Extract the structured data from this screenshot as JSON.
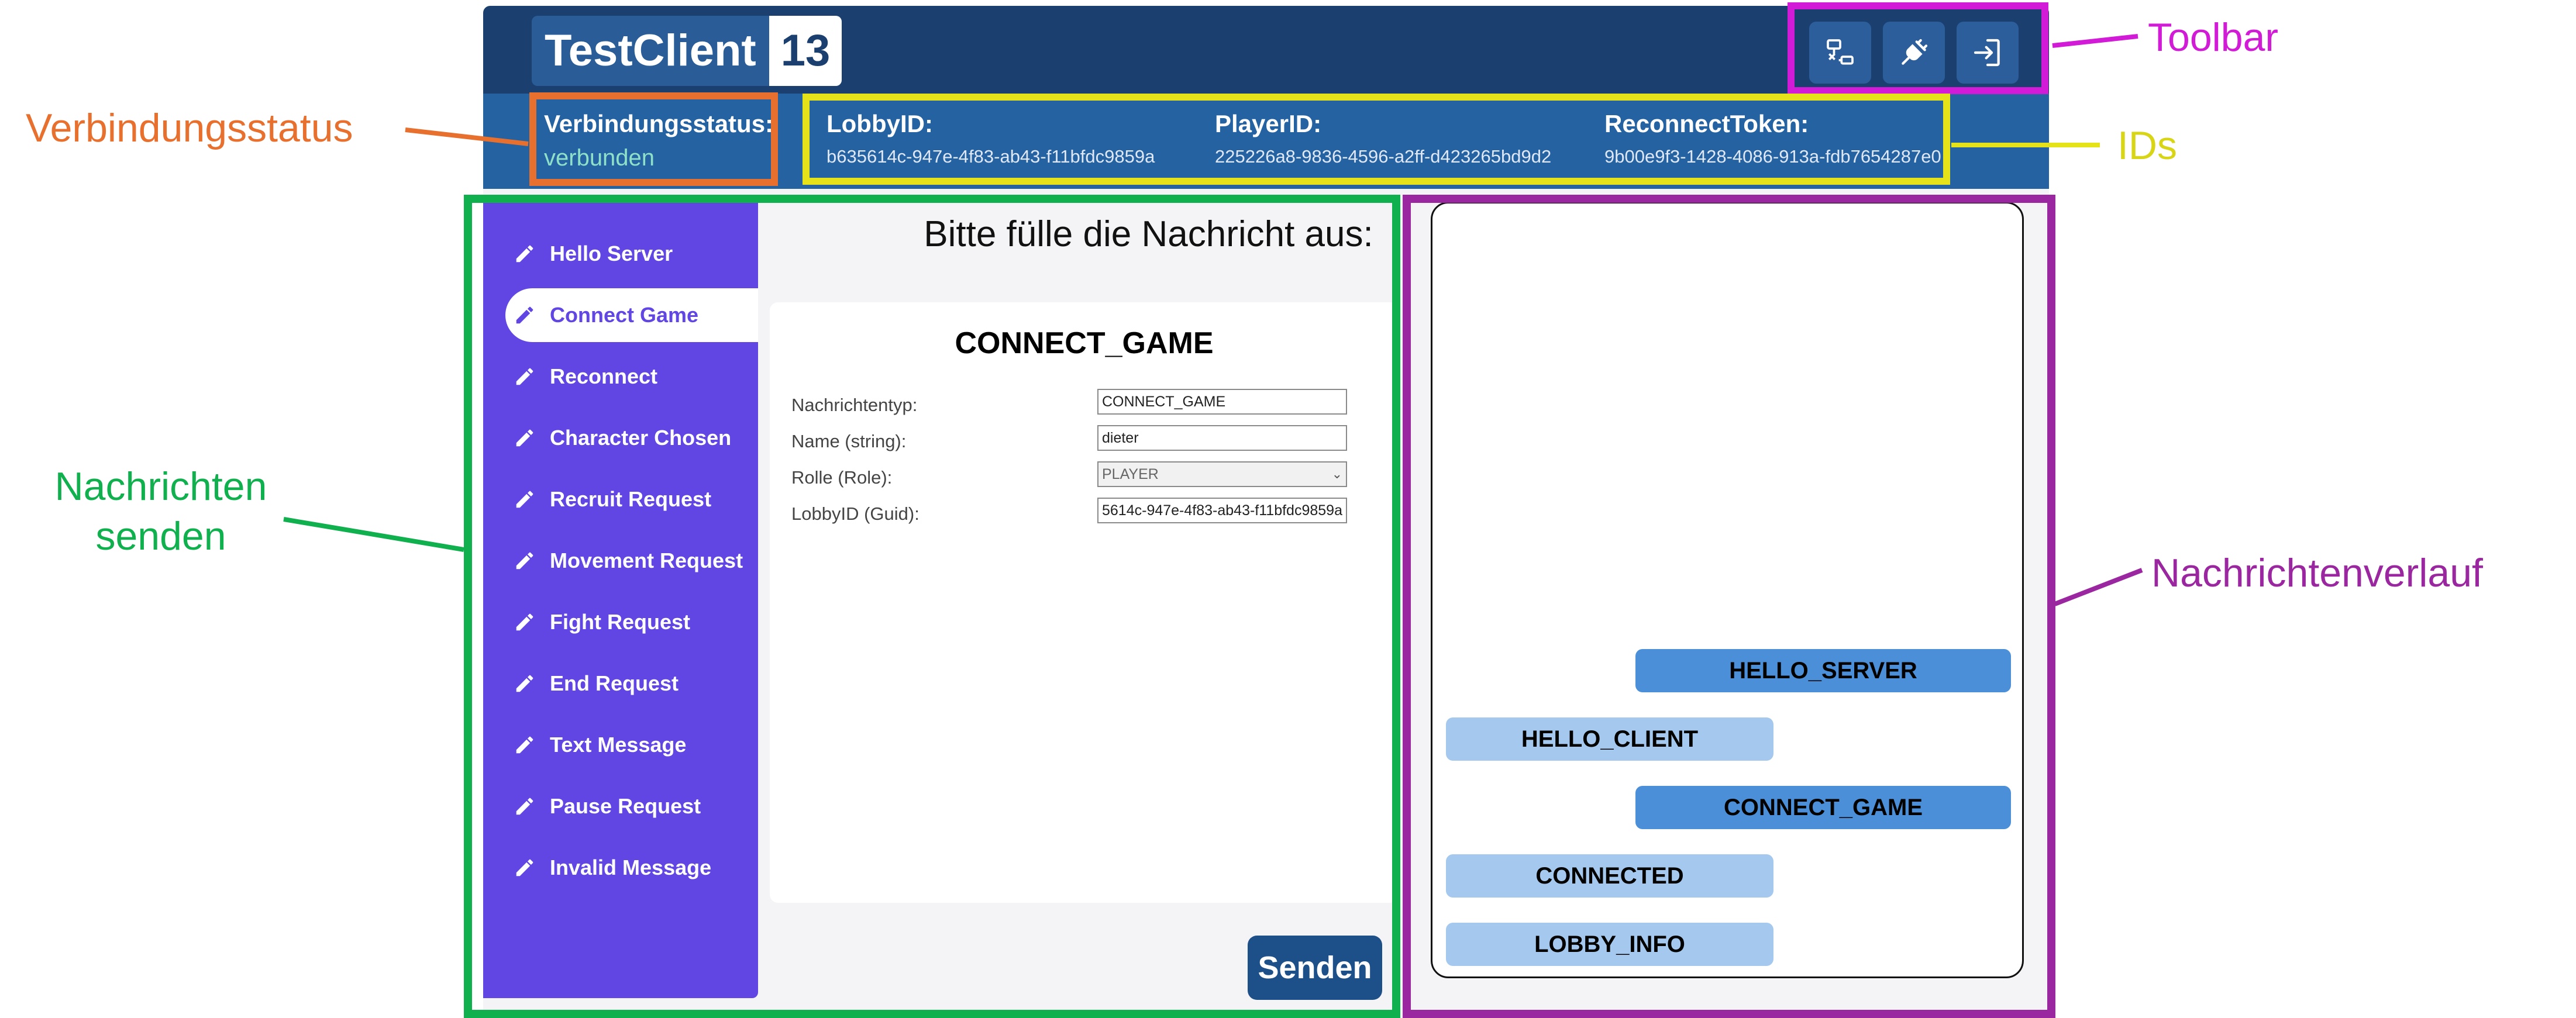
{
  "app": {
    "name": "TestClient",
    "version_badge": "13",
    "toolbar_icons": [
      "network-disconnect-icon",
      "plug-icon",
      "exit-icon"
    ]
  },
  "connection": {
    "label": "Verbindungsstatus:",
    "value": "verbunden"
  },
  "ids": [
    {
      "label": "LobbyID:",
      "value": "b635614c-947e-4f83-ab43-f11bfdc9859a"
    },
    {
      "label": "PlayerID:",
      "value": "225226a8-9836-4596-a2ff-d423265bd9d2"
    },
    {
      "label": "ReconnectToken:",
      "value": "9b00e9f3-1428-4086-913a-fdb7654287e0"
    }
  ],
  "sidebar": {
    "items": [
      {
        "label": "Hello Server"
      },
      {
        "label": "Connect Game",
        "active": true
      },
      {
        "label": "Reconnect"
      },
      {
        "label": "Character Chosen"
      },
      {
        "label": "Recruit Request"
      },
      {
        "label": "Movement Request"
      },
      {
        "label": "Fight Request"
      },
      {
        "label": "End Request"
      },
      {
        "label": "Text Message"
      },
      {
        "label": "Pause Request"
      },
      {
        "label": "Invalid Message"
      }
    ]
  },
  "form": {
    "prompt": "Bitte fülle die Nachricht aus:",
    "title": "CONNECT_GAME",
    "fields": [
      {
        "label": "Nachrichtentyp:",
        "value": "CONNECT_GAME"
      },
      {
        "label": "Name (string):",
        "value": "dieter"
      },
      {
        "label": "Rolle (Role):",
        "value": "PLAYER"
      },
      {
        "label": "LobbyID (Guid):",
        "value": "5614c-947e-4f83-ab43-f11bfdc9859a"
      }
    ],
    "send_label": "Senden"
  },
  "history": {
    "messages": [
      {
        "text": "HELLO_SERVER",
        "direction": "out"
      },
      {
        "text": "HELLO_CLIENT",
        "direction": "in"
      },
      {
        "text": "CONNECT_GAME",
        "direction": "out"
      },
      {
        "text": "CONNECTED",
        "direction": "in"
      },
      {
        "text": "LOBBY_INFO",
        "direction": "in"
      }
    ]
  },
  "annotations": {
    "toolbar": {
      "text": "Toolbar",
      "color": "#d21bd6"
    },
    "connection_status": {
      "text": "Verbindungsstatus",
      "color": "#e8702e"
    },
    "ids": {
      "text": "IDs",
      "color": "#e6e21a"
    },
    "send_messages": {
      "text": "Nachrichten\nsenden",
      "color": "#0fb04d"
    },
    "history": {
      "text": "Nachrichtenverlauf",
      "color": "#9b27a0"
    }
  },
  "colors": {
    "header_dark": "#1b3f6e",
    "header_bar": "#2462a2",
    "sidebar": "#6246e3",
    "status_ok": "#8fe0c8",
    "send_button": "#1d4f88",
    "msg_out": "#4a8fd8",
    "msg_in": "#a4c8ee"
  }
}
